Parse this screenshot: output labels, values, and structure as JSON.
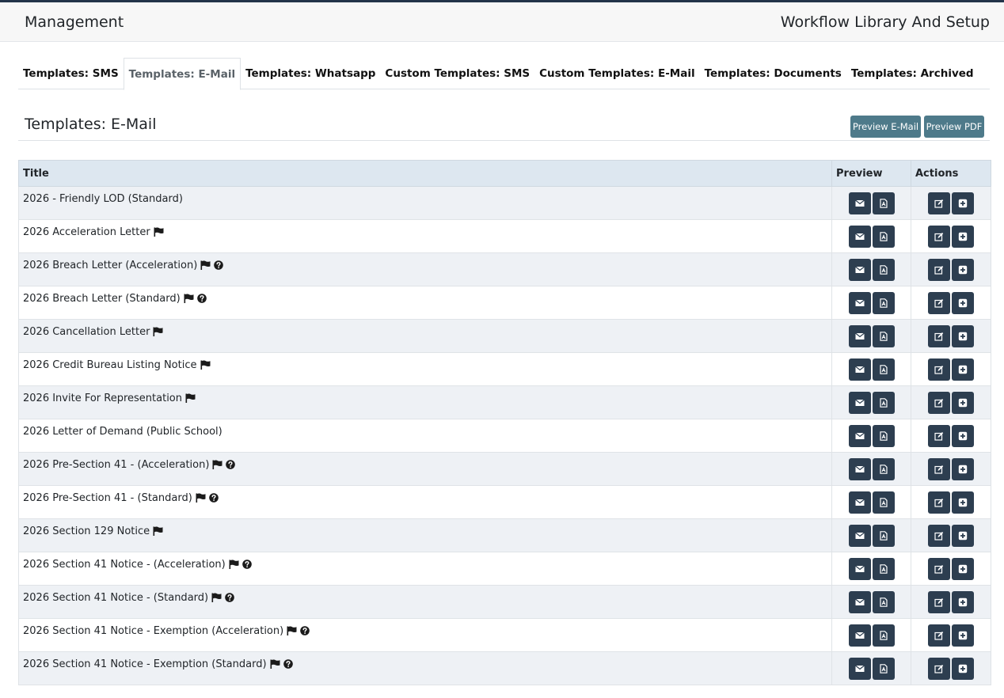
{
  "header": {
    "left_title": "Management",
    "right_title": "Workflow Library And Setup"
  },
  "tabs": [
    {
      "label": "Templates: SMS",
      "active": false
    },
    {
      "label": "Templates: E-Mail",
      "active": true
    },
    {
      "label": "Templates: Whatsapp",
      "active": false
    },
    {
      "label": "Custom Templates: SMS",
      "active": false
    },
    {
      "label": "Custom Templates: E-Mail",
      "active": false
    },
    {
      "label": "Templates: Documents",
      "active": false
    },
    {
      "label": "Templates: Archived",
      "active": false
    }
  ],
  "section": {
    "title": "Templates: E-Mail",
    "preview_email_label": "Preview E-Mail",
    "preview_pdf_label": "Preview PDF"
  },
  "table": {
    "headers": {
      "title": "Title",
      "preview": "Preview",
      "actions": "Actions"
    },
    "rows": [
      {
        "title": "2026 - Friendly LOD (Standard)",
        "flag": false,
        "help": false
      },
      {
        "title": "2026 Acceleration Letter",
        "flag": true,
        "help": false
      },
      {
        "title": "2026 Breach Letter (Acceleration)",
        "flag": true,
        "help": true
      },
      {
        "title": "2026 Breach Letter (Standard)",
        "flag": true,
        "help": true
      },
      {
        "title": "2026 Cancellation Letter",
        "flag": true,
        "help": false
      },
      {
        "title": "2026 Credit Bureau Listing Notice",
        "flag": true,
        "help": false
      },
      {
        "title": "2026 Invite For Representation",
        "flag": true,
        "help": false
      },
      {
        "title": "2026 Letter of Demand (Public School)",
        "flag": false,
        "help": false
      },
      {
        "title": "2026 Pre-Section 41 - (Acceleration)",
        "flag": true,
        "help": true
      },
      {
        "title": "2026 Pre-Section 41 - (Standard)",
        "flag": true,
        "help": true
      },
      {
        "title": "2026 Section 129 Notice",
        "flag": true,
        "help": false
      },
      {
        "title": "2026 Section 41 Notice - (Acceleration)",
        "flag": true,
        "help": true
      },
      {
        "title": "2026 Section 41 Notice - (Standard)",
        "flag": true,
        "help": true
      },
      {
        "title": "2026 Section 41 Notice - Exemption (Acceleration)",
        "flag": true,
        "help": true
      },
      {
        "title": "2026 Section 41 Notice - Exemption (Standard)",
        "flag": true,
        "help": true
      }
    ]
  },
  "icons": {
    "preview": [
      "envelope-icon",
      "pdf-file-icon"
    ],
    "actions": [
      "edit-icon",
      "plus-icon"
    ],
    "title": [
      "flag-icon",
      "question-circle-icon"
    ]
  },
  "colors": {
    "header_bg": "#f7f7f7",
    "top_border": "#23344a",
    "preview_button": "#4e7a8a",
    "icon_button": "#2d3e50",
    "table_header_bg": "#dde7f0",
    "row_alt_bg": "#eef1f5"
  }
}
